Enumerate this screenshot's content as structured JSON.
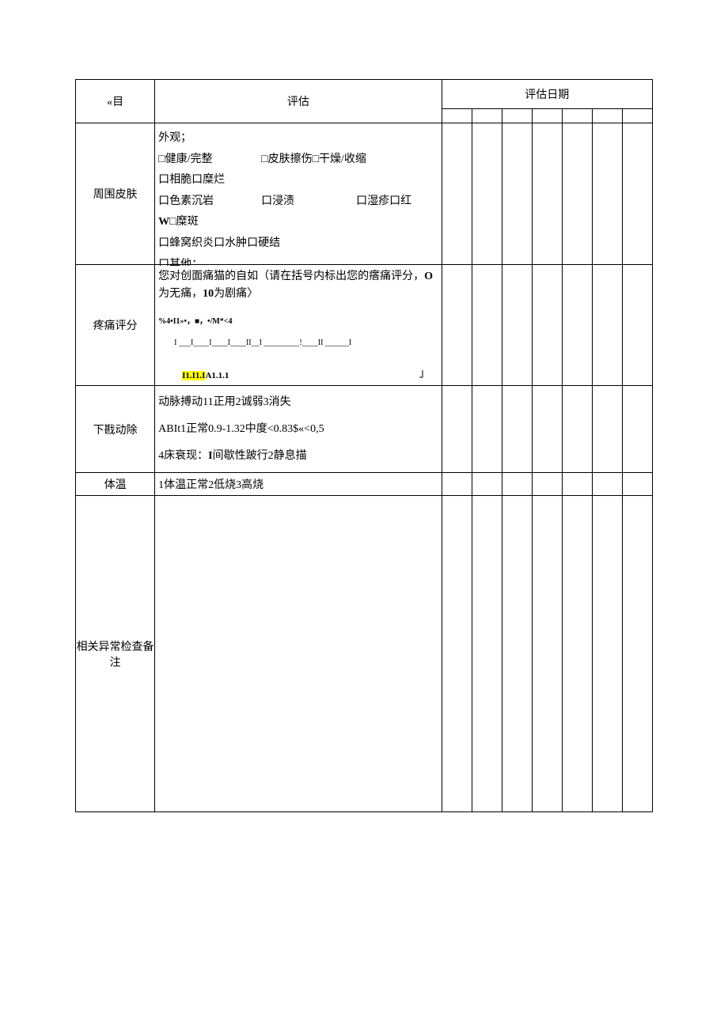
{
  "header": {
    "col_mu": "«目",
    "col_assess": "评估",
    "col_date": "评估日期"
  },
  "rows": {
    "skin": {
      "label": "周围皮肤",
      "line1": "外观；",
      "line2a": "□健康/完整",
      "line2b": "□皮肤擦伤□干燥/收缩",
      "line3": "口相脆口糜烂",
      "line4a": "口色素沉岩",
      "line4b": "口浸渍",
      "line4c": "口湿疹口红",
      "line5a": "W",
      "line5b": "□糜斑",
      "line6": "口蜂窝织炎口水肿口硬结",
      "line7": "口其他："
    },
    "pain": {
      "label": "疼痛评分",
      "prompt_a": "您对创面痛猫的自如（请在括号内标出您的瘩痛评分，",
      "prompt_o": "O",
      "prompt_b": "为无痛，",
      "prompt_c": "10",
      "prompt_d": "为剧痛〉",
      "formula": "%4•I1»•，■，•/M*<4",
      "scale": "I ___I____I____I____II__I _________!____II ______I",
      "code_hl1": "I1.I1.I",
      "code_hl2": "A",
      "code_plain": "1.1.1",
      "bracket": "」"
    },
    "artery": {
      "label": "下戡动除",
      "line1": "动脉搏动11正用2诚弱3消失",
      "line2": "ABIt1正常0.9-1.32中度<0.83$«<0,5",
      "line3a": "4床衰现：",
      "line3b": "I",
      "line3c": "间歇性跛行2静息描"
    },
    "temp": {
      "label": "体温",
      "content": "1体温正常2低烧3高烧"
    },
    "notes": {
      "label": "相关异常检查备注"
    }
  }
}
